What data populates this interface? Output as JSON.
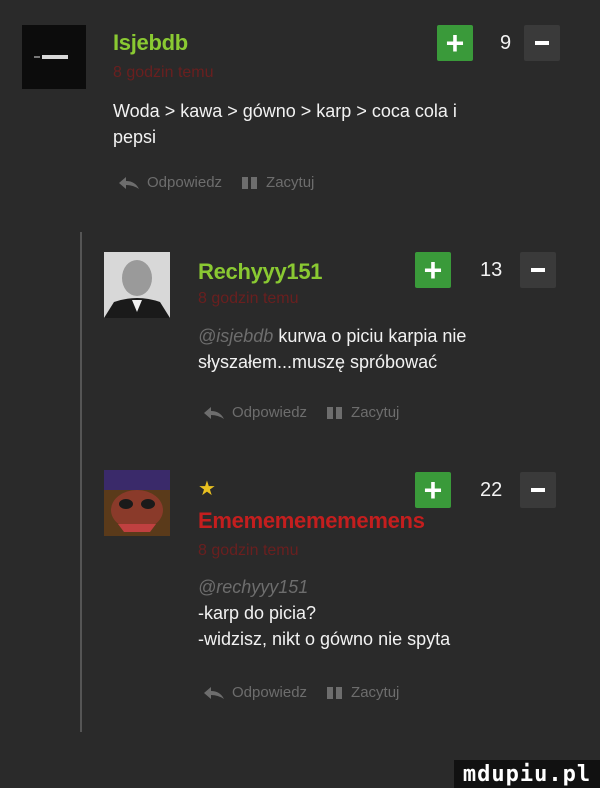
{
  "comments": [
    {
      "username": "Isjebdb",
      "username_color": "#8ac932",
      "time": "8 godzin temu",
      "lines": [
        "Woda > kawa > gówno > karp > coca cola i",
        "pepsi"
      ],
      "score": "9",
      "reply_label": "Odpowiedz",
      "quote_label": "Zacytuj"
    },
    {
      "username": "Rechyyy151",
      "username_color": "#8ac932",
      "time": "8 godzin temu",
      "mention": "@isjebdb",
      "first_line_rest": "kurwa o piciu karpia nie",
      "lines": [
        "słyszałem...muszę spróbować"
      ],
      "score": "13",
      "reply_label": "Odpowiedz",
      "quote_label": "Zacytuj"
    },
    {
      "username": "Ememememememens",
      "username_color": "#c41e1e",
      "star": "★",
      "time": "8 godzin temu",
      "mention": "@rechyyy151",
      "lines": [
        "-karp do picia?",
        "-widzisz, nikt o gówno nie spyta"
      ],
      "score": "22",
      "reply_label": "Odpowiedz",
      "quote_label": "Zacytuj"
    }
  ],
  "watermark": "mdupiu.pl",
  "colors": {
    "plus": "#3a9a3a",
    "minus": "#3a3a3a",
    "background": "#2a2a2a"
  }
}
